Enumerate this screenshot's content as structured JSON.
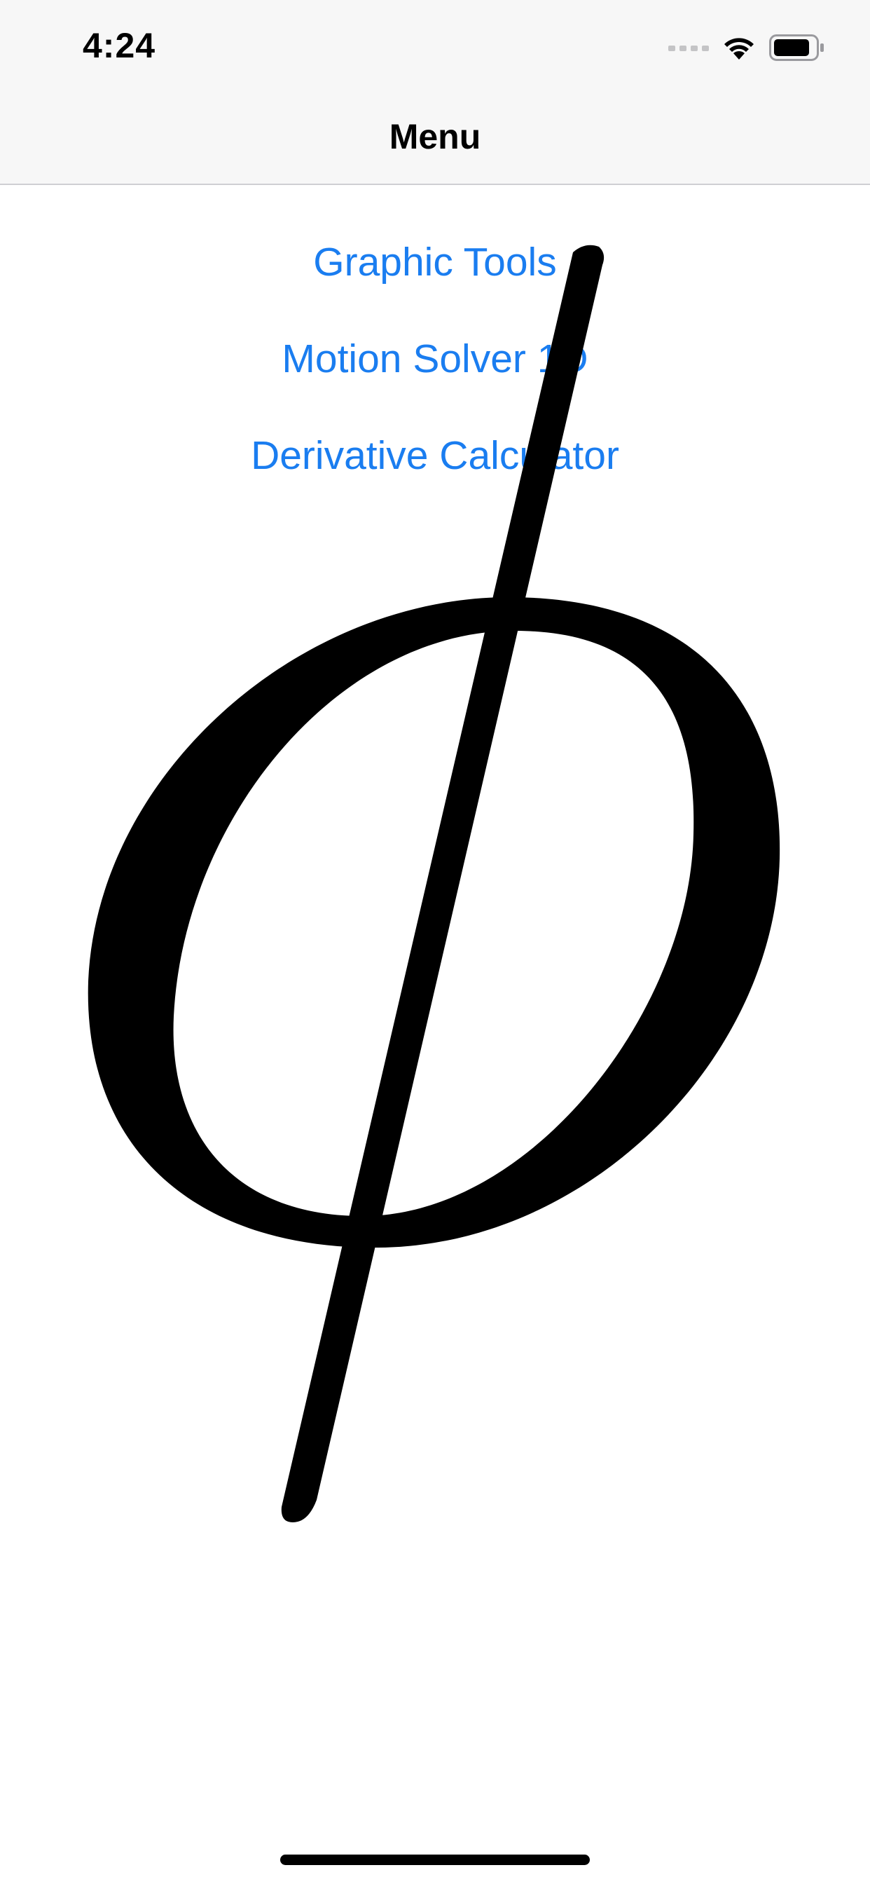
{
  "status_bar": {
    "time": "4:24",
    "icons": [
      "signal-dots-icon",
      "wifi-icon",
      "battery-icon"
    ]
  },
  "nav": {
    "title": "Menu"
  },
  "menu": {
    "items": [
      {
        "label": "Graphic Tools"
      },
      {
        "label": "Motion Solver 1D"
      },
      {
        "label": "Derivative Calculator"
      }
    ]
  },
  "artwork": {
    "glyph": "phi-symbol-icon",
    "color": "#000000"
  },
  "colors": {
    "link": "#1a7df0",
    "nav_background": "#f7f7f7",
    "separator": "#cfcfd3"
  }
}
